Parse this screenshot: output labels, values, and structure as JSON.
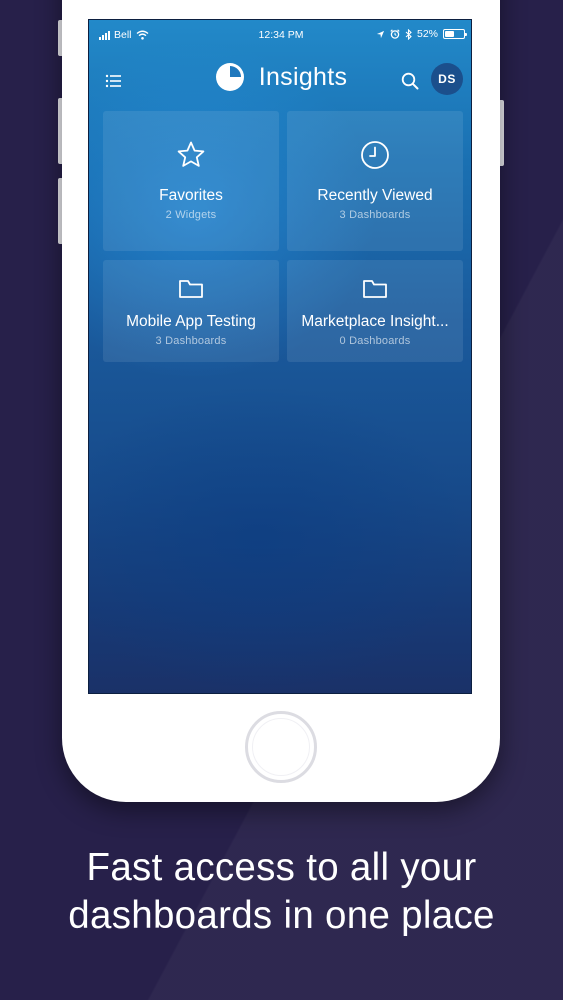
{
  "status_bar": {
    "carrier": "Bell",
    "time": "12:34 PM",
    "battery_percent": "52%",
    "battery_level": 0.52
  },
  "header": {
    "title": "Insights",
    "avatar_initials": "DS",
    "icons": {
      "menu": "list-menu-icon",
      "logo": "pie-chart-logo-icon",
      "search": "search-icon"
    }
  },
  "tiles": [
    {
      "title": "Favorites",
      "subtitle": "2 Widgets",
      "icon": "star-icon"
    },
    {
      "title": "Recently Viewed",
      "subtitle": "3 Dashboards",
      "icon": "clock-icon"
    },
    {
      "title": "Mobile App Testing",
      "subtitle": "3 Dashboards",
      "icon": "folder-icon"
    },
    {
      "title": "Marketplace Insight...",
      "subtitle": "0 Dashboards",
      "icon": "folder-icon"
    }
  ],
  "caption": {
    "line1": "Fast access to all your",
    "line2": "dashboards in one place"
  },
  "colors": {
    "page_background": "#27204a",
    "screen_top": "#2289c9",
    "screen_bottom": "#1a3168",
    "avatar_background": "#1b4f8c"
  }
}
